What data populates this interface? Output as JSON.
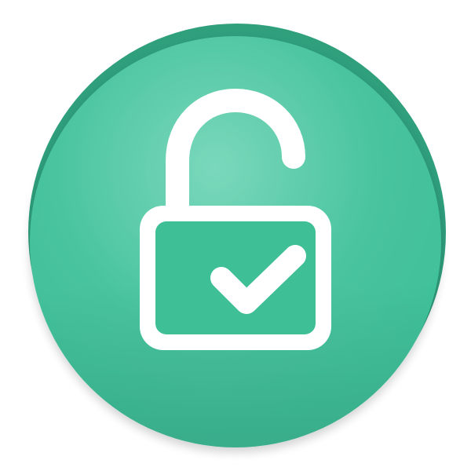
{
  "icon": {
    "name": "unlocked-padlock-check-icon",
    "base_color": "#3dbf98",
    "rim_color": "#2f9f7c",
    "highlight_color": "#7ad8bb",
    "glyph_color": "#ffffff",
    "inner_fill": "#3fbf96"
  }
}
